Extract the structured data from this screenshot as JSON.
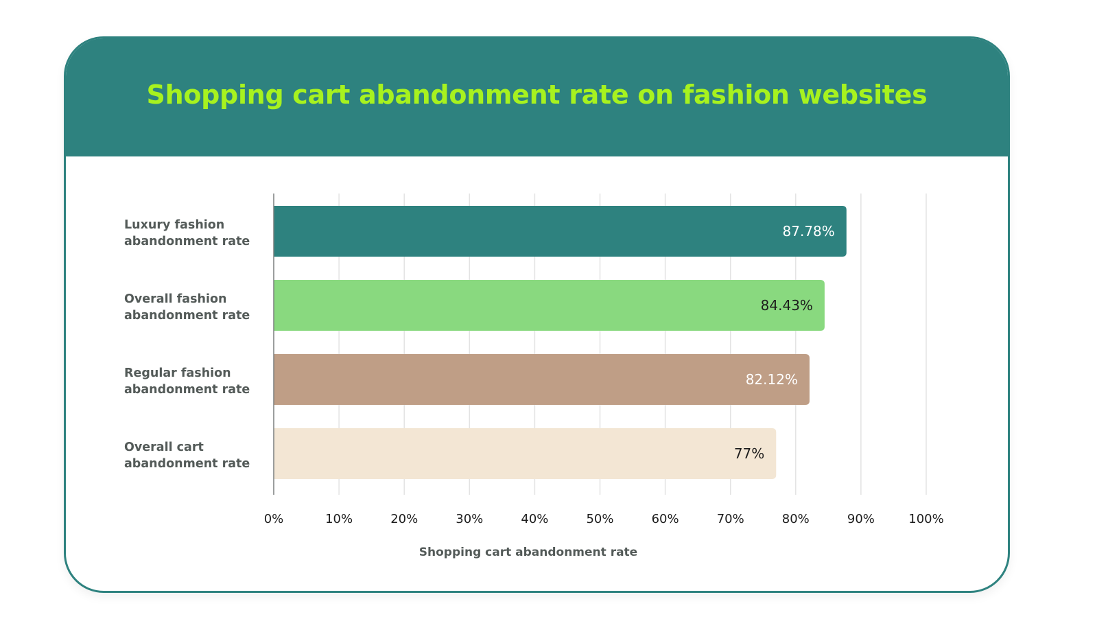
{
  "chart_data": {
    "type": "bar",
    "orientation": "horizontal",
    "title": "Shopping cart abandonment rate on fashion websites",
    "xlabel": "Shopping cart abandonment rate",
    "ylabel": "",
    "xlim": [
      0,
      100
    ],
    "grid": true,
    "legend": "none",
    "categories": [
      [
        "Luxury fashion",
        "abandonment rate"
      ],
      [
        "Overall fashion",
        "abandonment rate"
      ],
      [
        "Regular fashion",
        "abandonment rate"
      ],
      [
        "Overall cart",
        "abandonment rate"
      ]
    ],
    "values": [
      87.78,
      84.43,
      82.12,
      77
    ],
    "value_labels": [
      "87.78%",
      "84.43%",
      "82.12%",
      "77%"
    ],
    "bar_colors": [
      "#2e827f",
      "#89d97f",
      "#bf9e86",
      "#f3e6d4"
    ],
    "value_label_colors": [
      "#ffffff",
      "#1d1d1d",
      "#ffffff",
      "#1d1d1d"
    ],
    "ticks": [
      0,
      10,
      20,
      30,
      40,
      50,
      60,
      70,
      80,
      90,
      100
    ],
    "tick_labels": [
      "0%",
      "10%",
      "20%",
      "30%",
      "40%",
      "50%",
      "60%",
      "70%",
      "80%",
      "90%",
      "100%"
    ]
  },
  "colors": {
    "header_bg": "#2e827f",
    "title_color": "#a7f21f",
    "border": "#2e827f"
  }
}
